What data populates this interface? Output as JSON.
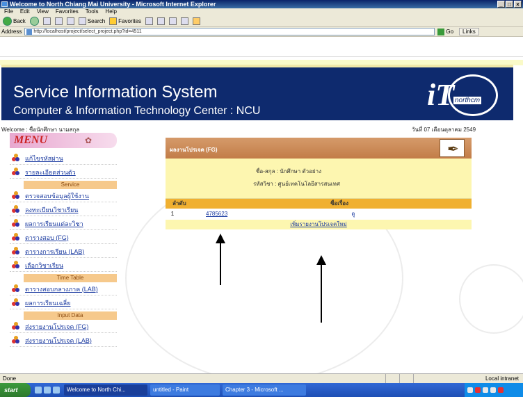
{
  "window": {
    "title": "Welcome to North Chiang Mai University - Microsoft Internet Explorer",
    "controls": [
      "_",
      "□",
      "×"
    ]
  },
  "menubar": [
    "File",
    "Edit",
    "View",
    "Favorites",
    "Tools",
    "Help"
  ],
  "toolbar": {
    "back": "Back",
    "search": "Search",
    "favorites": "Favorites"
  },
  "address": {
    "label": "Address",
    "url": "http://localhost/project/select_project.php?id=4511",
    "go": "Go",
    "links": "Links"
  },
  "banner": {
    "title": "Service Information System",
    "subtitle": "Computer & Information Technology Center : NCU",
    "logo_letter": "iT",
    "logo_text": "northcm"
  },
  "header": {
    "welcome": "Welcome : ชื่อนักศึกษา นามสกุล",
    "date": "วันที่ 07 เดือนตุลาคม 2549"
  },
  "sidebar": {
    "menu_title": "MENU",
    "items": [
      {
        "label": "แก้ไขรหัสผ่าน"
      },
      {
        "label": "รายละเอียดส่วนตัว"
      },
      {
        "label": "ตรวจสอบข้อมูลผู้ใช้งาน"
      },
      {
        "label": "ลงทะเบียนวิชาเรียน"
      },
      {
        "label": "ผลการเรียนแต่ละวิชา"
      },
      {
        "label": "ตารางสอบ (FG)"
      },
      {
        "label": "ตารางการเรียน (LAB)"
      },
      {
        "label": "เลือกวิชาเรียน"
      },
      {
        "label": "ตารางสอบกลางภาค (LAB)"
      },
      {
        "label": "ผลการเรียนเฉลี่ย"
      },
      {
        "label": "ส่งรายงานโปรเจค (FG)"
      },
      {
        "label": "ส่งรายงานโปรเจค (LAB)"
      }
    ],
    "sections": [
      "Service",
      "Time Table",
      "Input Data"
    ]
  },
  "panel": {
    "title": "ผลงานโปรเจค (FG)",
    "info_line1": "ชื่อ-สกุล : นักศึกษา  ตัวอย่าง",
    "info_line2": "รหัสวิชา : ศูนย์เทคโนโลยีสารสนเทศ",
    "col_no": "ลำดับ",
    "col_name": "ชื่อเรื่อง",
    "rows": [
      {
        "no": "1",
        "file": "4785623",
        "name": "ดู"
      }
    ],
    "footer_link": "เพิ่มรายงานโปรเจคใหม่"
  },
  "statusbar": {
    "text": "Done",
    "zone": "Local intranet"
  },
  "taskbar": {
    "start": "start",
    "tasks": [
      "Welcome to North Chi...",
      "untitled - Paint",
      "Chapter 3 - Microsoft ..."
    ]
  }
}
